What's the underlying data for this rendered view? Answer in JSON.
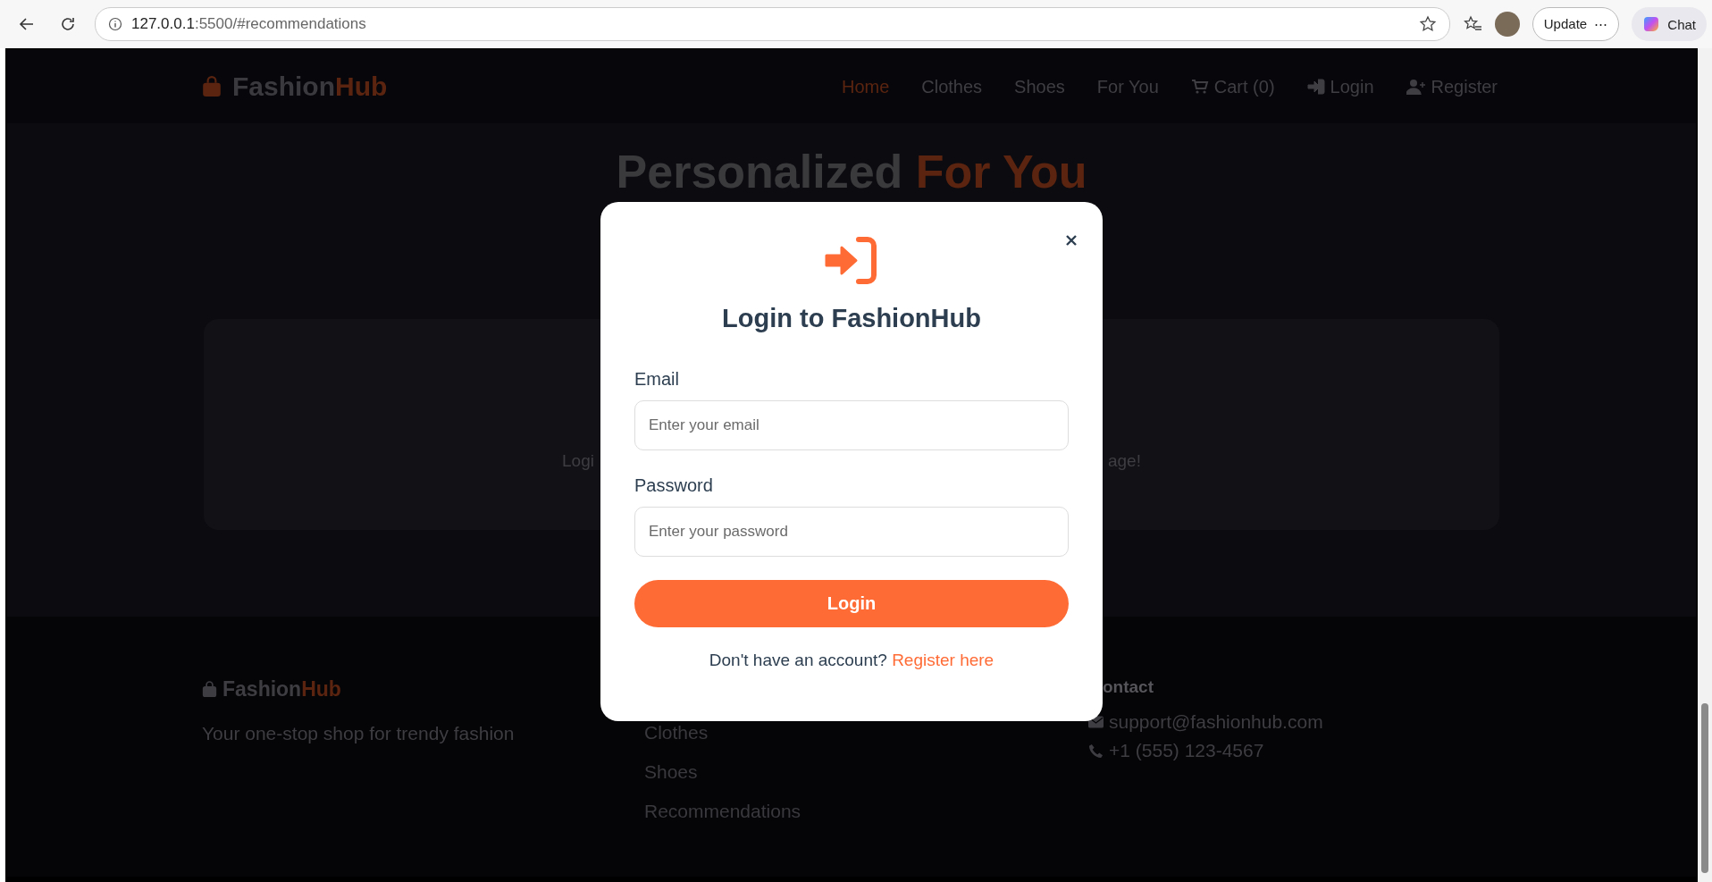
{
  "browser": {
    "url_host": "127.0.0.1",
    "url_rest": ":5500/#recommendations",
    "update_button": "Update",
    "update_more": "⋯",
    "chat_button": "Chat"
  },
  "header": {
    "logo_start": "Fashion",
    "logo_end": "Hub",
    "nav": [
      {
        "label": "Home",
        "selected": true,
        "kind": "plain"
      },
      {
        "label": "Clothes",
        "selected": false,
        "kind": "plain"
      },
      {
        "label": "Shoes",
        "selected": false,
        "kind": "plain"
      },
      {
        "label": "For You",
        "selected": false,
        "kind": "plain"
      },
      {
        "label": "Cart (0)",
        "selected": false,
        "kind": "cart"
      },
      {
        "label": "Login",
        "selected": false,
        "kind": "login"
      },
      {
        "label": "Register",
        "selected": false,
        "kind": "register"
      }
    ]
  },
  "hero": {
    "title_start": "Personalized",
    "title_end": "For You"
  },
  "card": {
    "text_start": "Logi",
    "text_end": "age!"
  },
  "footer": {
    "logo_start": "Fashion",
    "logo_end": "Hub",
    "tagline": "Your one-stop shop for trendy fashion",
    "links": [
      "Clothes",
      "Shoes",
      "Recommendations"
    ],
    "contact_heading": "ontact",
    "contact": [
      {
        "kind": "mail",
        "text": "support@fashionhub.com"
      },
      {
        "kind": "phone",
        "text": "+1 (555) 123-4567"
      }
    ]
  },
  "modal": {
    "title": "Login to FashionHub",
    "email_label": "Email",
    "email_placeholder": "Enter your email",
    "password_label": "Password",
    "password_placeholder": "Enter your password",
    "submit": "Login",
    "prompt": "Don't have an account?",
    "link": "Register here"
  }
}
